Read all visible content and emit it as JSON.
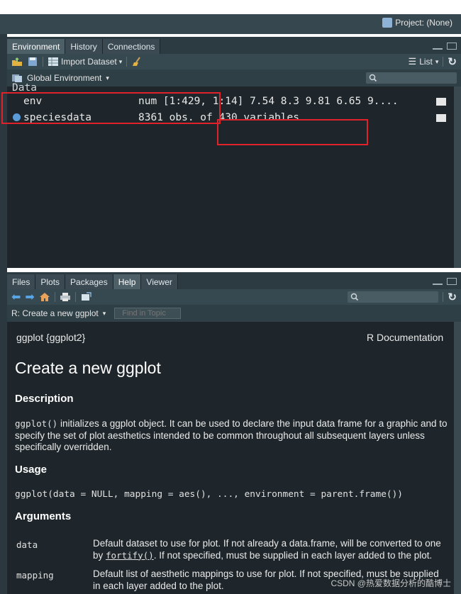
{
  "topbar": {
    "project_label": "Project: (None)"
  },
  "env_pane": {
    "tabs": [
      "Environment",
      "History",
      "Connections"
    ],
    "toolbar": {
      "import_label": "Import Dataset",
      "list_label": "List"
    },
    "scope_label": "Global Environment",
    "section_header": "Data",
    "rows": [
      {
        "name": "env",
        "value": "num [1:429, 1:14] 7.54 8.3 9.81 6.65 9...."
      },
      {
        "name": "speciesdata",
        "value": "8361 obs. of 430 variables"
      }
    ]
  },
  "help_pane": {
    "tabs": [
      "Files",
      "Plots",
      "Packages",
      "Help",
      "Viewer"
    ],
    "topic_label": "R: Create a new ggplot",
    "find_placeholder": "Find in Topic",
    "header_left": "ggplot {ggplot2}",
    "header_right": "R Documentation",
    "title": "Create a new ggplot",
    "description_heading": "Description",
    "description_code": "ggplot()",
    "description_text": " initializes a ggplot object. It can be used to declare the input data frame for a graphic and to specify the set of plot aesthetics intended to be common throughout all subsequent layers unless specifically overridden.",
    "usage_heading": "Usage",
    "usage_code": "ggplot(data = NULL, mapping = aes(), ..., environment = parent.frame())",
    "arguments_heading": "Arguments",
    "args": [
      {
        "name": "data",
        "text_a": "Default dataset to use for plot. If not already a data.frame, will be converted to one by ",
        "link": "fortify()",
        "text_b": ". If not specified, must be supplied in each layer added to the plot."
      },
      {
        "name": "mapping",
        "text_a": "Default list of aesthetic mappings to use for plot. If not specified, must be supplied in each layer added to the plot."
      }
    ]
  },
  "watermark": "CSDN @热爱数据分析的酷博士"
}
